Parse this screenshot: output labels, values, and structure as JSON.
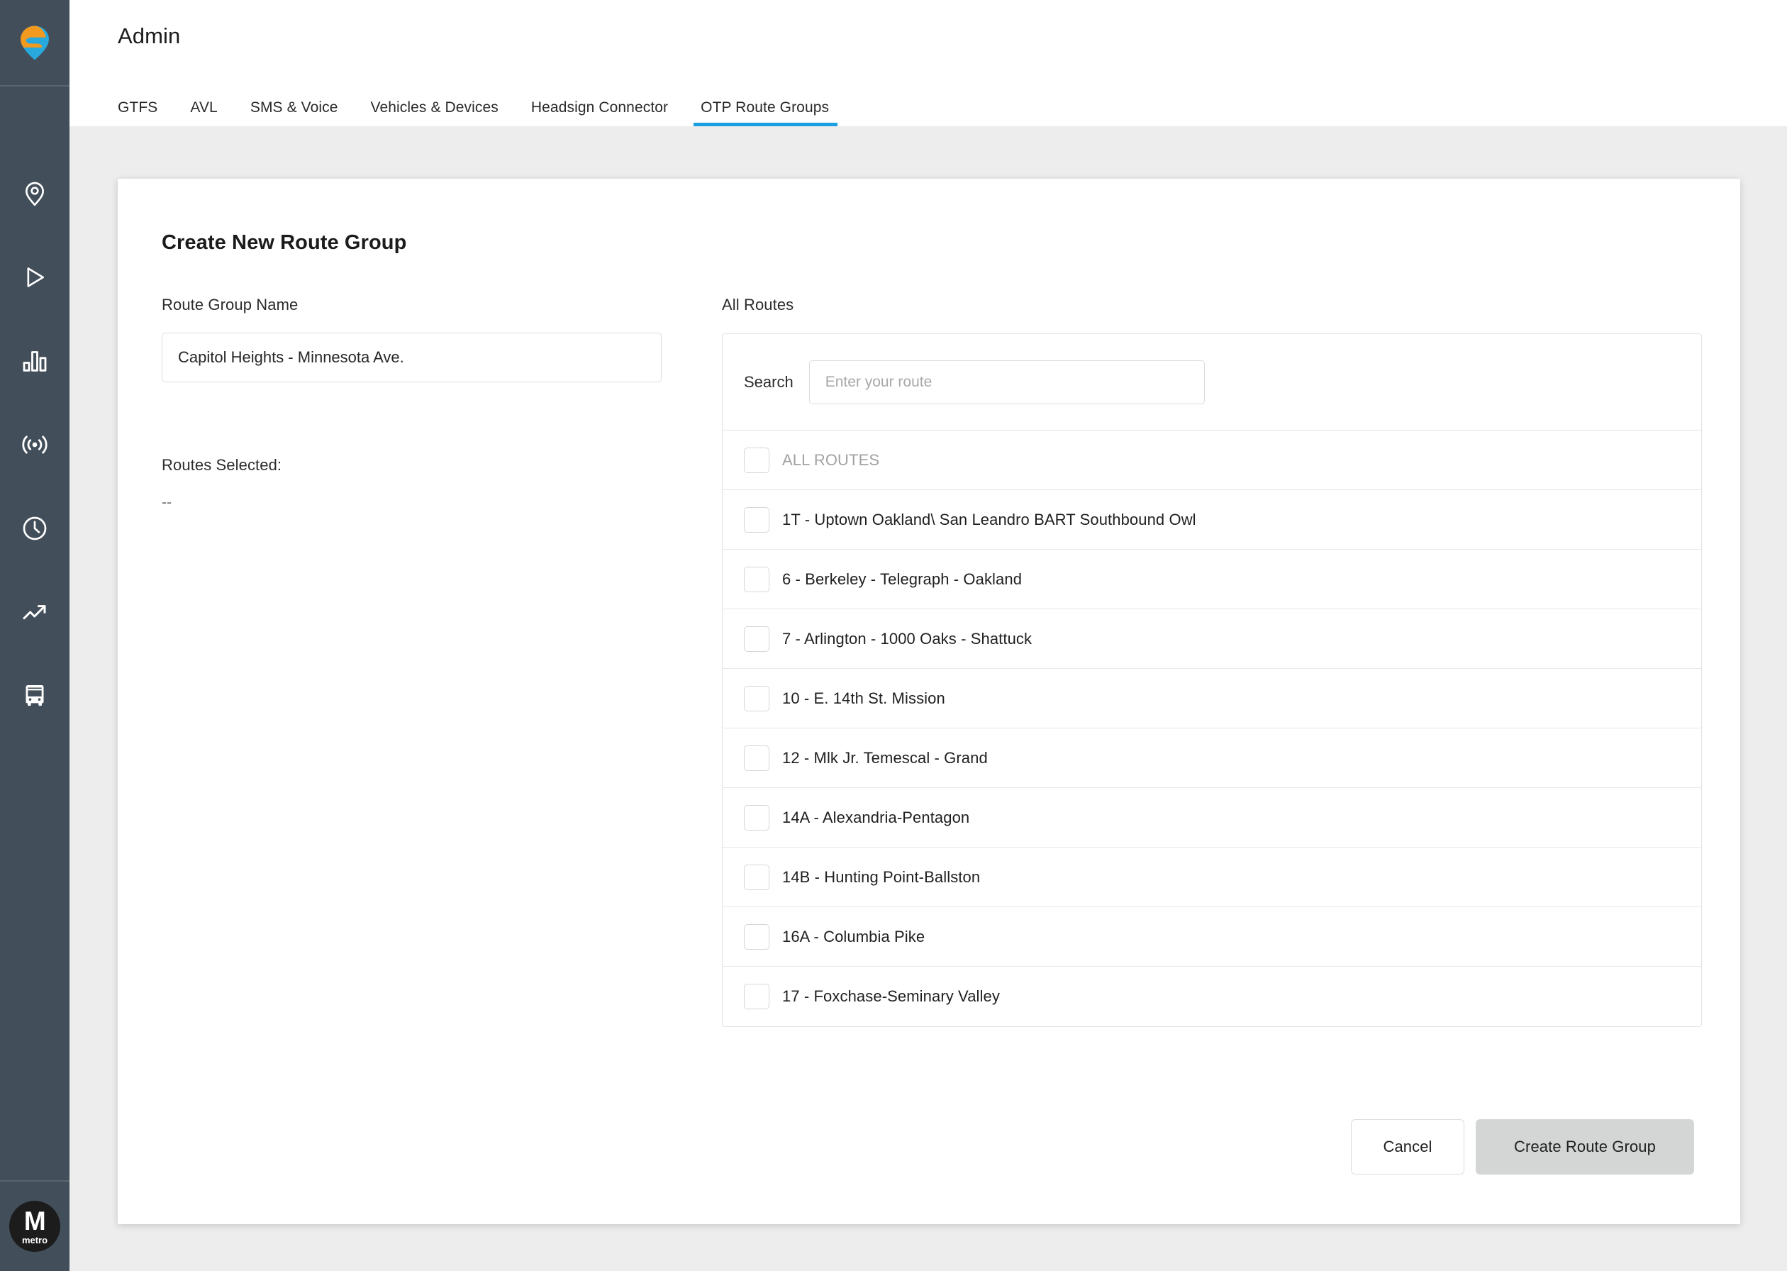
{
  "brand": {
    "logo_icon": "swiftly-pin-logo",
    "logo_colors": {
      "orange": "#F29A1F",
      "cyan": "#27A9DE"
    },
    "sidebar_bg": "#424E5A"
  },
  "sidebar": {
    "items": [
      {
        "icon": "map-pin-icon",
        "name": "sidebar-item-map"
      },
      {
        "icon": "play-icon",
        "name": "sidebar-item-playback"
      },
      {
        "icon": "bar-chart-icon",
        "name": "sidebar-item-reports"
      },
      {
        "icon": "broadcast-icon",
        "name": "sidebar-item-live"
      },
      {
        "icon": "clock-icon",
        "name": "sidebar-item-schedule"
      },
      {
        "icon": "trending-up-icon",
        "name": "sidebar-item-trends"
      },
      {
        "icon": "bus-icon",
        "name": "sidebar-item-vehicles"
      }
    ],
    "avatar": {
      "letter": "M",
      "word": "metro"
    }
  },
  "header": {
    "title": "Admin",
    "tabs": [
      {
        "label": "GTFS",
        "active": false
      },
      {
        "label": "AVL",
        "active": false
      },
      {
        "label": "SMS & Voice",
        "active": false
      },
      {
        "label": "Vehicles & Devices",
        "active": false
      },
      {
        "label": "Headsign Connector",
        "active": false
      },
      {
        "label": "OTP Route Groups",
        "active": true
      }
    ],
    "active_tab_color": "#1A9FE0"
  },
  "card": {
    "title": "Create New Route Group",
    "left": {
      "name_label": "Route Group Name",
      "name_value": "Capitol Heights - Minnesota Ave.",
      "name_placeholder": "",
      "routes_selected_label": "Routes Selected:",
      "routes_selected_value": "--"
    },
    "right": {
      "all_routes_label": "All Routes",
      "search_label": "Search",
      "search_value": "",
      "search_placeholder": "Enter your route",
      "select_all_label": "ALL ROUTES",
      "select_all_checked": false,
      "routes": [
        {
          "label": "1T - Uptown Oakland\\ San Leandro BART Southbound Owl",
          "checked": false
        },
        {
          "label": "6 - Berkeley - Telegraph - Oakland",
          "checked": false
        },
        {
          "label": "7 - Arlington - 1000 Oaks - Shattuck",
          "checked": false
        },
        {
          "label": "10 - E. 14th St. Mission",
          "checked": false
        },
        {
          "label": "12 - Mlk Jr. Temescal - Grand",
          "checked": false
        },
        {
          "label": "14A - Alexandria-Pentagon",
          "checked": false
        },
        {
          "label": "14B - Hunting Point-Ballston",
          "checked": false
        },
        {
          "label": "16A - Columbia Pike",
          "checked": false
        },
        {
          "label": "17 - Foxchase-Seminary Valley",
          "checked": false
        }
      ]
    },
    "footer": {
      "cancel_label": "Cancel",
      "create_label": "Create Route Group"
    }
  }
}
